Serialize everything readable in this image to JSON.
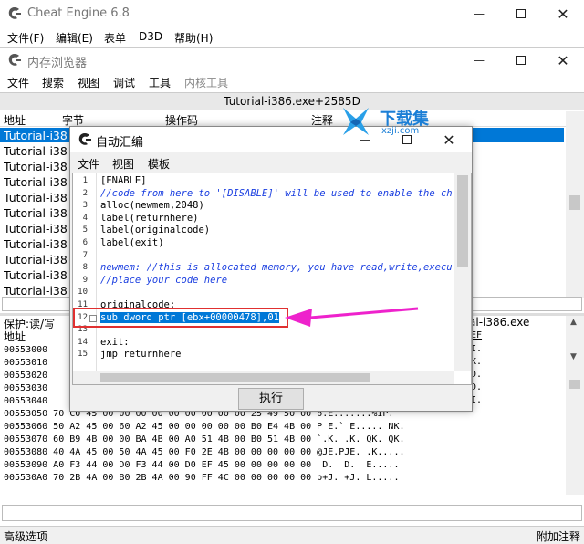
{
  "main": {
    "title": "Cheat Engine 6.8",
    "menu": [
      "文件(F)",
      "编辑(E)",
      "表单",
      "D3D",
      "帮助(H)"
    ],
    "bottom_left": "高级选项",
    "bottom_right": "附加注释"
  },
  "memview": {
    "title": "内存浏览器",
    "menu": [
      "文件",
      "搜索",
      "视图",
      "调试",
      "工具",
      "内核工具"
    ],
    "address_bar": "Tutorial-i386.exe+2585D",
    "columns": [
      "地址",
      "字节",
      "操作码",
      "注释"
    ],
    "disasm_rows": [
      "Tutorial-i38",
      "Tutorial-i38",
      "Tutorial-i38",
      "Tutorial-i38",
      "Tutorial-i38",
      "Tutorial-i38",
      "Tutorial-i38",
      "Tutorial-i38",
      "Tutorial-i38",
      "Tutorial-i38",
      "Tutorial-i38"
    ],
    "disasm_rows_suffix": [
      "",
      "",
      "",
      "",
      "",
      "",
      "",
      "",
      "",
      "",
      ""
    ],
    "hex_protect": "保护:读/写",
    "hex_module_right": "al-i386.exe",
    "hex_addr_header": "地址",
    "hex_ascii_header": "EF",
    "hex_rows_left": [
      "00553000",
      "00553010",
      "00553020",
      "00553030",
      "00553040"
    ],
    "hex_rows_full": [
      "00553050 70 C0 45 00 00 00 00 00 00 00 00 00 25 49 50 00 p.E.......%IP.  ",
      "00553060 50 A2 45 00 60 A2 45 00 00 00 00 00 B0 E4 4B 00 P E.` E..... NK.",
      "00553070 60 B9 4B 00 00 BA 4B 00 A0 51 4B 00 B0 51 4B 00 `.K. .K. QK. QK.",
      "00553080 40 4A 45 00 50 4A 45 00 F0 2E 4B 00 00 00 00 00 @JE.PJE. .K.....",
      "00553090 A0 F3 44 00 D0 F3 44 00 D0 EF 45 00 00 00 00 00  D.  D.  E.....",
      "005530A0 70 2B 4A 00 B0 2B 4A 00 90 FF 4C 00 00 00 00 00 p+J. +J. L....."
    ],
    "hex_ascii_right": [
      "I.",
      "K.",
      "D.",
      "D.",
      "I.",
      "I."
    ]
  },
  "autoasm": {
    "title": "自动汇编",
    "menu": [
      "文件",
      "视图",
      "模板"
    ],
    "execute_label": "执行",
    "code_lines": [
      {
        "n": "1",
        "text": "[ENABLE]",
        "style": "normal"
      },
      {
        "n": "2",
        "text": "//code from here to '[DISABLE]' will be used to enable the ch",
        "style": "comment"
      },
      {
        "n": "3",
        "text": "alloc(newmem,2048)",
        "style": "normal"
      },
      {
        "n": "4",
        "text": "label(returnhere)",
        "style": "normal"
      },
      {
        "n": "5",
        "text": "label(originalcode)",
        "style": "normal"
      },
      {
        "n": "6",
        "text": "label(exit)",
        "style": "normal"
      },
      {
        "n": "7",
        "text": "",
        "style": "normal"
      },
      {
        "n": "8",
        "text": "newmem: //this is allocated memory, you have read,write,execu",
        "style": "mixed"
      },
      {
        "n": "9",
        "text": "//place your code here",
        "style": "comment"
      },
      {
        "n": "10",
        "text": "",
        "style": "normal"
      },
      {
        "n": "11",
        "text": "originalcode:",
        "style": "normal"
      },
      {
        "n": "12",
        "text": "sub dword ptr [ebx+00000478],01",
        "style": "selected"
      },
      {
        "n": "13",
        "text": "",
        "style": "normal"
      },
      {
        "n": "14",
        "text": "exit:",
        "style": "normal"
      },
      {
        "n": "15",
        "text": "jmp returnhere",
        "style": "normal"
      }
    ]
  },
  "watermark": {
    "text": "下载集",
    "sub": "xzji.com"
  },
  "colors": {
    "selection": "#0078d7",
    "annotation": "#ee22cc",
    "highlight_box": "#e03030",
    "comment": "#1a3ee0"
  }
}
